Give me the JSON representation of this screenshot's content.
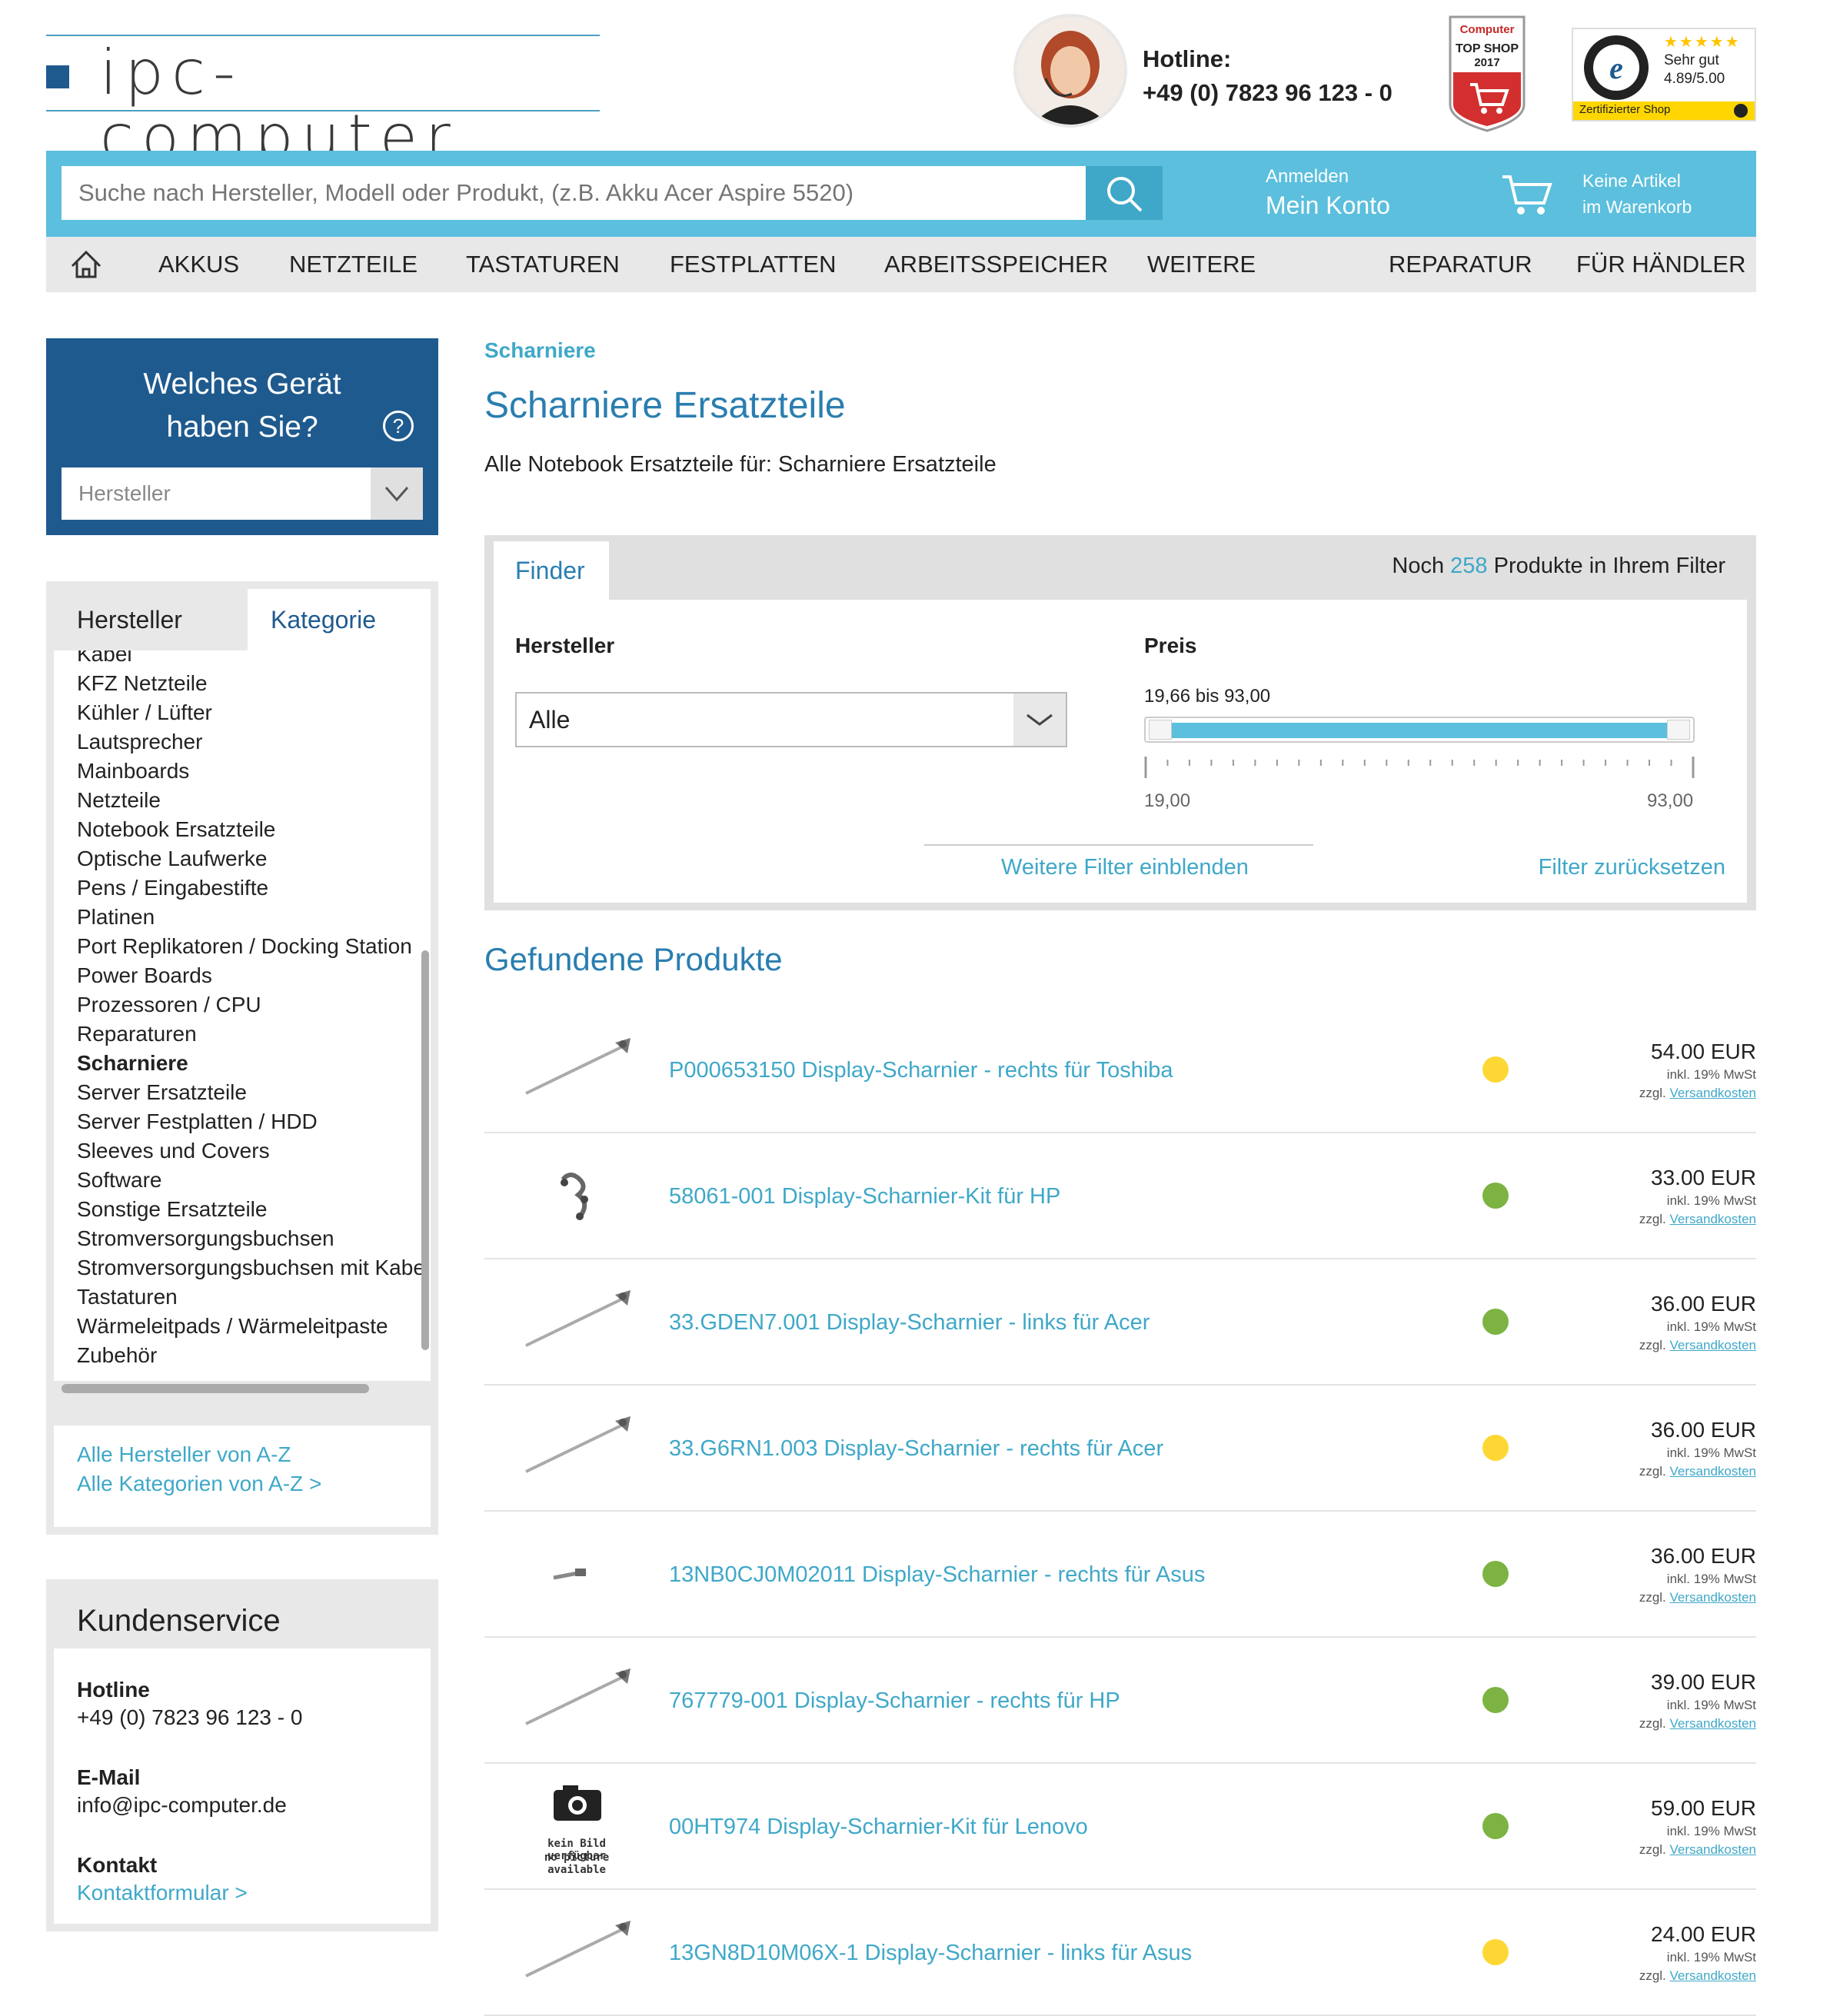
{
  "header": {
    "logo_text": "ipc-computer",
    "hotline_label": "Hotline:",
    "hotline_number": "+49 (0) 7823 96 123 - 0",
    "badge_computer": {
      "brand": "Computer",
      "title": "TOP SHOP",
      "year": "2017"
    },
    "badge_trusted": {
      "rating_text": "Sehr gut",
      "score": "4.89/5.00",
      "footer": "Zertifizierter Shop",
      "stars": "★★★★★"
    }
  },
  "search": {
    "placeholder": "Suche nach Hersteller, Modell oder Produkt, (z.B. Akku Acer Aspire 5520)",
    "account_small": "Anmelden",
    "account_big": "Mein Konto",
    "cart_line1": "Keine Artikel",
    "cart_line2": "im Warenkorb"
  },
  "nav": {
    "items": [
      "AKKUS",
      "NETZTEILE",
      "TASTATUREN",
      "FESTPLATTEN",
      "ARBEITSSPEICHER",
      "WEITERE",
      "REPARATUR",
      "FÜR HÄNDLER"
    ]
  },
  "sidebar": {
    "device_title_1": "Welches Gerät",
    "device_title_2": "haben Sie?",
    "help": "?",
    "device_select": "Hersteller",
    "tab_manufacturer": "Hersteller",
    "tab_category": "Kategorie",
    "categories": [
      "Kabel",
      "KFZ Netzteile",
      "Kühler / Lüfter",
      "Lautsprecher",
      "Mainboards",
      "Netzteile",
      "Notebook Ersatzteile",
      "Optische Laufwerke",
      "Pens / Eingabestifte",
      "Platinen",
      "Port Replikatoren / Docking Station",
      "Power Boards",
      "Prozessoren / CPU",
      "Reparaturen",
      "Scharniere",
      "Server Ersatzteile",
      "Server Festplatten / HDD",
      "Sleeves und Covers",
      "Software",
      "Sonstige Ersatzteile",
      "Stromversorgungsbuchsen",
      "Stromversorgungsbuchsen mit Kabel",
      "Tastaturen",
      "Wärmeleitpads / Wärmeleitpaste",
      "Zubehör"
    ],
    "active_category": "Scharniere",
    "link_all_manufacturers": "Alle Hersteller von A-Z",
    "link_all_categories": "Alle Kategorien von A-Z >"
  },
  "service": {
    "title": "Kundenservice",
    "hotline_label": "Hotline",
    "hotline_value": "+49 (0) 7823 96 123 - 0",
    "email_label": "E-Mail",
    "email_value": "info@ipc-computer.de",
    "contact_label": "Kontakt",
    "contact_link": "Kontaktformular >"
  },
  "main": {
    "breadcrumb": "Scharniere",
    "title": "Scharniere Ersatzteile",
    "intro": "Alle Notebook Ersatzteile für: Scharniere Ersatzteile"
  },
  "finder": {
    "tab": "Finder",
    "count_pre": "Noch",
    "count": "258",
    "count_post": "Produkte in Ihrem Filter",
    "manufacturer_label": "Hersteller",
    "manufacturer_value": "Alle",
    "price_label": "Preis",
    "price_range": "19,66 bis 93,00",
    "price_min": "19,00",
    "price_max": "93,00",
    "more_filters": "Weitere Filter einblenden",
    "reset": "Filter zurücksetzen"
  },
  "results": {
    "title": "Gefundene Produkte",
    "tax_note": "inkl. 19% MwSt",
    "shipping_pre": "zzgl.",
    "shipping_link": "Versandkosten",
    "no_image_1": "kein Bild verfügbar",
    "no_image_2": "no picture available",
    "products": [
      {
        "name": "P000653150 Display-Scharnier - rechts für Toshiba",
        "price": "54.00 EUR",
        "availability": "yellow",
        "image": "hinge"
      },
      {
        "name": "58061-001 Display-Scharnier-Kit für HP",
        "price": "33.00 EUR",
        "availability": "green",
        "image": "kit"
      },
      {
        "name": "33.GDEN7.001 Display-Scharnier - links für Acer",
        "price": "36.00 EUR",
        "availability": "green",
        "image": "hinge"
      },
      {
        "name": "33.G6RN1.003 Display-Scharnier - rechts für Acer",
        "price": "36.00 EUR",
        "availability": "yellow",
        "image": "hinge"
      },
      {
        "name": "13NB0CJ0M02011 Display-Scharnier - rechts für Asus",
        "price": "36.00 EUR",
        "availability": "green",
        "image": "small"
      },
      {
        "name": "767779-001 Display-Scharnier - rechts für HP",
        "price": "39.00 EUR",
        "availability": "green",
        "image": "hinge"
      },
      {
        "name": "00HT974 Display-Scharnier-Kit für Lenovo",
        "price": "59.00 EUR",
        "availability": "green",
        "image": "none"
      },
      {
        "name": "13GN8D10M06X-1 Display-Scharnier - links für Asus",
        "price": "24.00 EUR",
        "availability": "yellow",
        "image": "hinge"
      }
    ]
  },
  "colors": {
    "brand_blue": "#1f5a8e",
    "accent": "#5bbfdd",
    "link": "#3fa8c8",
    "available": "#7cb342",
    "limited": "#fdd835"
  }
}
